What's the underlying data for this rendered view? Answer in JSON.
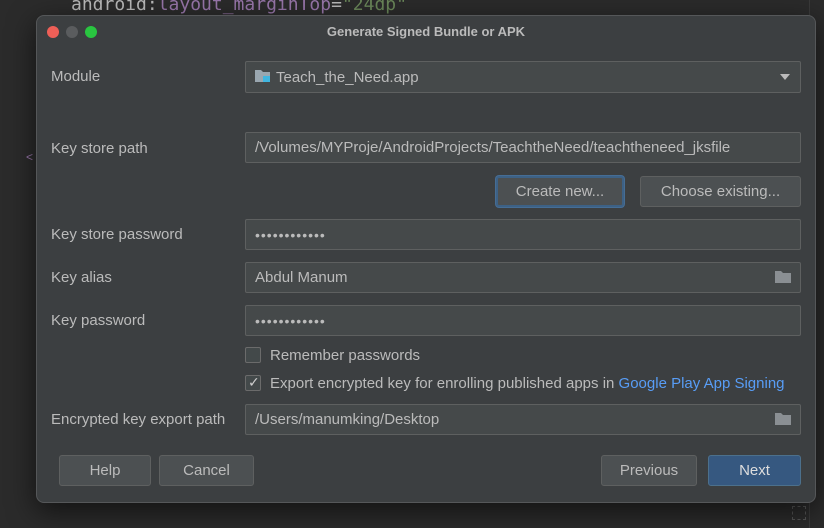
{
  "editor": {
    "line_attr_ns": "android",
    "line_attr_sep": ":",
    "line_attr_name": "layout_marginTop",
    "line_eq": "=",
    "line_value": "\"24dp\""
  },
  "dialog": {
    "title": "Generate Signed Bundle or APK",
    "module_label": "Module",
    "module_value": "Teach_the_Need.app",
    "keystore_path_label": "Key store path",
    "keystore_path_value": "/Volumes/MYProje/AndroidProjects/TeachtheNeed/teachtheneed_jksfile",
    "create_new_label": "Create new...",
    "choose_existing_label": "Choose existing...",
    "keystore_password_label": "Key store password",
    "keystore_password_value": "••••••••••••",
    "key_alias_label": "Key alias",
    "key_alias_value": "Abdul Manum",
    "key_password_label": "Key password",
    "key_password_value": "••••••••••••",
    "remember_passwords_label": "Remember passwords",
    "remember_passwords_checked": false,
    "export_key_label": "Export encrypted key for enrolling published apps in ",
    "export_key_link": "Google Play App Signing",
    "export_key_checked": true,
    "export_path_label": "Encrypted key export path",
    "export_path_value": "/Users/manumking/Desktop",
    "help_label": "Help",
    "cancel_label": "Cancel",
    "previous_label": "Previous",
    "next_label": "Next"
  },
  "icons": [
    "module-icon",
    "folder-icon",
    "chevron-down-icon",
    "checkmark-icon"
  ],
  "colors": {
    "dialog_bg": "#3c3f41",
    "field_bg": "#45494a",
    "primary_button": "#365880",
    "link": "#589df6"
  }
}
